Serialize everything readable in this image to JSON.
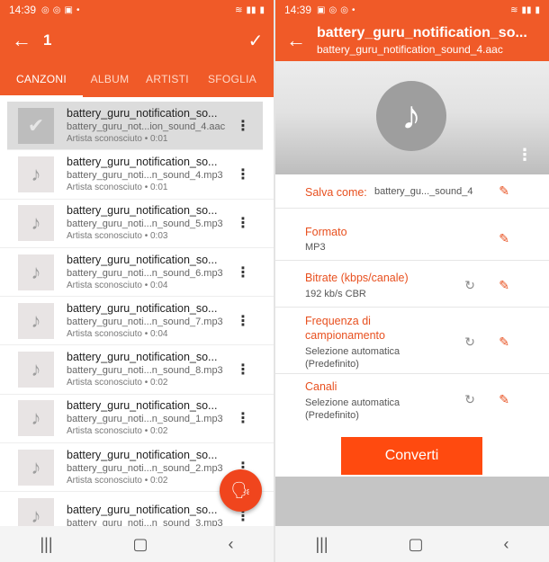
{
  "left": {
    "status": {
      "time": "14:39"
    },
    "appbar": {
      "back_icon": "back-arrow",
      "selected_count": "1",
      "check_icon": "check"
    },
    "tabs": [
      "CANZONI",
      "ALBUM",
      "ARTISTI",
      "SFOGLIA"
    ],
    "songs": [
      {
        "title": "battery_guru_notification_so...",
        "file": "battery_guru_not...ion_sound_4.aac",
        "meta": "Artista sconosciuto • 0:01"
      },
      {
        "title": "battery_guru_notification_so...",
        "file": "battery_guru_noti...n_sound_4.mp3",
        "meta": "Artista sconosciuto • 0:01"
      },
      {
        "title": "battery_guru_notification_so...",
        "file": "battery_guru_noti...n_sound_5.mp3",
        "meta": "Artista sconosciuto • 0:03"
      },
      {
        "title": "battery_guru_notification_so...",
        "file": "battery_guru_noti...n_sound_6.mp3",
        "meta": "Artista sconosciuto • 0:04"
      },
      {
        "title": "battery_guru_notification_so...",
        "file": "battery_guru_noti...n_sound_7.mp3",
        "meta": "Artista sconosciuto • 0:04"
      },
      {
        "title": "battery_guru_notification_so...",
        "file": "battery_guru_noti...n_sound_8.mp3",
        "meta": "Artista sconosciuto • 0:02"
      },
      {
        "title": "battery_guru_notification_so...",
        "file": "battery_guru_noti...n_sound_1.mp3",
        "meta": "Artista sconosciuto • 0:02"
      },
      {
        "title": "battery_guru_notification_so...",
        "file": "battery_guru_noti...n_sound_2.mp3",
        "meta": "Artista sconosciuto • 0:02"
      },
      {
        "title": "battery_guru_notification_so...",
        "file": "battery_guru_noti...n_sound_3.mp3",
        "meta": ""
      }
    ]
  },
  "right": {
    "status": {
      "time": "14:39"
    },
    "appbar": {
      "title": "battery_guru_notification_so...",
      "subtitle": "battery_guru_notification_sound_4.aac"
    },
    "save_as": {
      "label": "Salva come:",
      "value": "battery_gu..._sound_4"
    },
    "settings": [
      {
        "label": "Formato",
        "value": "MP3",
        "resettable": false
      },
      {
        "label": "Bitrate (kbps/canale)",
        "value": "192 kb/s CBR",
        "resettable": true
      },
      {
        "label": "Frequenza di campionamento",
        "value": "Selezione automatica (Predefinito)",
        "resettable": true
      },
      {
        "label": "Canali",
        "value": "Selezione automatica (Predefinito)",
        "resettable": true
      }
    ],
    "convert_label": "Converti"
  },
  "colors": {
    "accent": "#f05a28",
    "button": "#ff4a0f"
  }
}
